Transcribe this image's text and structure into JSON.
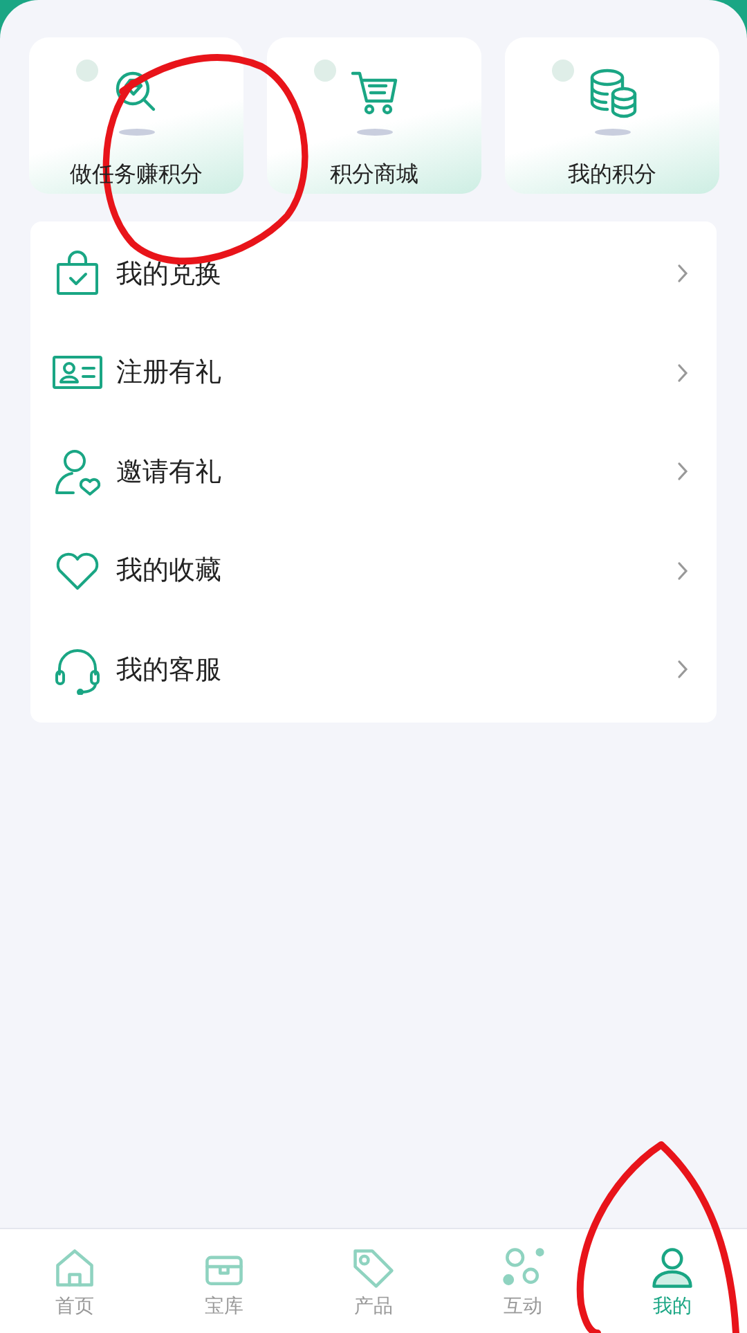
{
  "shortcuts": [
    {
      "label": "做任务赚积分",
      "kind": "task"
    },
    {
      "label": "积分商城",
      "kind": "cart"
    },
    {
      "label": "我的积分",
      "kind": "coins"
    }
  ],
  "menu": [
    {
      "label": "我的兑换",
      "kind": "bag"
    },
    {
      "label": "注册有礼",
      "kind": "card"
    },
    {
      "label": "邀请有礼",
      "kind": "invite"
    },
    {
      "label": "我的收藏",
      "kind": "heart"
    },
    {
      "label": "我的客服",
      "kind": "headset"
    }
  ],
  "tabs": [
    {
      "label": "首页",
      "kind": "home",
      "selected": false
    },
    {
      "label": "宝库",
      "kind": "treasure",
      "selected": false
    },
    {
      "label": "产品",
      "kind": "tag",
      "selected": false
    },
    {
      "label": "互动",
      "kind": "bubbles",
      "selected": false
    },
    {
      "label": "我的",
      "kind": "user",
      "selected": true
    }
  ]
}
